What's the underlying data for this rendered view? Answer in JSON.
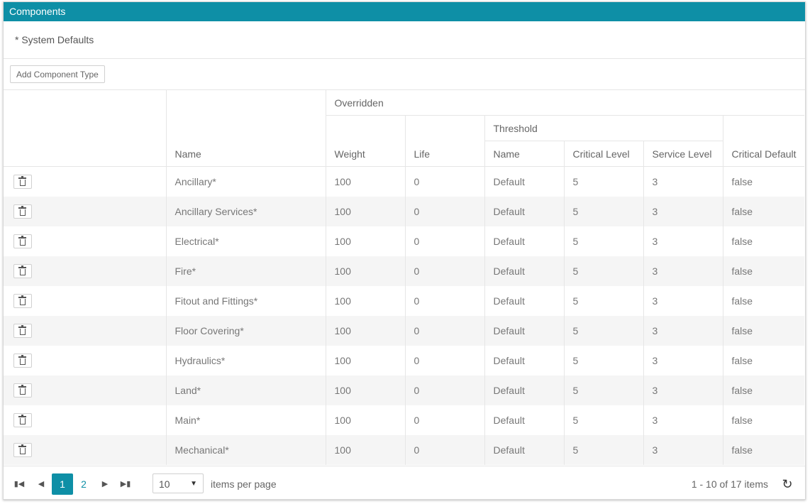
{
  "panel": {
    "title": "Components"
  },
  "defaults_note": "* System Defaults",
  "toolbar": {
    "add_label": "Add Component Type"
  },
  "header": {
    "overridden": "Overridden",
    "threshold": "Threshold",
    "name": "Name",
    "weight": "Weight",
    "life": "Life",
    "threshold_name": "Name",
    "critical_level": "Critical Level",
    "service_level": "Service Level",
    "critical_default": "Critical Default"
  },
  "rows": [
    {
      "name": "Ancillary*",
      "weight": "100",
      "life": "0",
      "threshold": "Default",
      "critical": "5",
      "service": "3",
      "critical_default": "false"
    },
    {
      "name": "Ancillary Services*",
      "weight": "100",
      "life": "0",
      "threshold": "Default",
      "critical": "5",
      "service": "3",
      "critical_default": "false"
    },
    {
      "name": "Electrical*",
      "weight": "100",
      "life": "0",
      "threshold": "Default",
      "critical": "5",
      "service": "3",
      "critical_default": "false"
    },
    {
      "name": "Fire*",
      "weight": "100",
      "life": "0",
      "threshold": "Default",
      "critical": "5",
      "service": "3",
      "critical_default": "false"
    },
    {
      "name": "Fitout and Fittings*",
      "weight": "100",
      "life": "0",
      "threshold": "Default",
      "critical": "5",
      "service": "3",
      "critical_default": "false"
    },
    {
      "name": "Floor Covering*",
      "weight": "100",
      "life": "0",
      "threshold": "Default",
      "critical": "5",
      "service": "3",
      "critical_default": "false"
    },
    {
      "name": "Hydraulics*",
      "weight": "100",
      "life": "0",
      "threshold": "Default",
      "critical": "5",
      "service": "3",
      "critical_default": "false"
    },
    {
      "name": "Land*",
      "weight": "100",
      "life": "0",
      "threshold": "Default",
      "critical": "5",
      "service": "3",
      "critical_default": "false"
    },
    {
      "name": "Main*",
      "weight": "100",
      "life": "0",
      "threshold": "Default",
      "critical": "5",
      "service": "3",
      "critical_default": "false"
    },
    {
      "name": "Mechanical*",
      "weight": "100",
      "life": "0",
      "threshold": "Default",
      "critical": "5",
      "service": "3",
      "critical_default": "false"
    }
  ],
  "pager": {
    "pages": [
      "1",
      "2"
    ],
    "page_size": "10",
    "items_per_page_label": "items per page",
    "info": "1 - 10 of 17 items"
  },
  "colors": {
    "accent": "#0e8fa6"
  },
  "icons": {
    "delete": "trash-icon",
    "first": "first-page-icon",
    "prev": "prev-page-icon",
    "next": "next-page-icon",
    "last": "last-page-icon",
    "refresh": "refresh-icon"
  }
}
